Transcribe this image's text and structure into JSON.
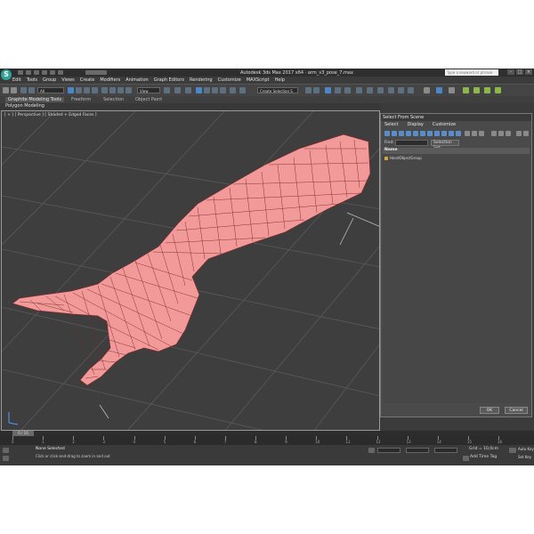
{
  "window": {
    "title": "Autodesk 3ds Max 2017 x64 · arm_v3_pose_7.max",
    "search_placeholder": "Type a keyword or phrase"
  },
  "menu": [
    "Edit",
    "Tools",
    "Group",
    "Views",
    "Create",
    "Modifiers",
    "Animation",
    "Graph Editors",
    "Rendering",
    "Customize",
    "MAXScript",
    "Help"
  ],
  "toolbar": {
    "filter_dropdown": "All",
    "reference_dropdown": "View",
    "selection_set_dropdown": "Create Selection S"
  },
  "ribbon": {
    "tabs": [
      "Graphite Modeling Tools",
      "Freeform",
      "Selection",
      "Object Paint"
    ],
    "active_tab": "Graphite Modeling Tools",
    "sub_label": "Polygon Modeling"
  },
  "viewport": {
    "label": "[ + ] [ Perspective ] [ Shaded + Edged Faces ]",
    "mesh_color": "#f29a9a",
    "wire_color": "#7a2a2a",
    "background": "#3e3e3e"
  },
  "dialog": {
    "title": "Select From Scene",
    "menu": [
      "Select",
      "Display",
      "Customize"
    ],
    "find_label": "Find:",
    "selection_set_label": "Selection Set:",
    "column_name": "Name",
    "rows": [
      "HandObjectGroup"
    ],
    "ok_label": "OK",
    "cancel_label": "Cancel"
  },
  "timeline": {
    "frame_display": "0 / 16",
    "ticks": [
      "0",
      "1",
      "2",
      "3",
      "4",
      "5",
      "6",
      "7",
      "8",
      "9",
      "10",
      "11",
      "12",
      "13",
      "14",
      "15",
      "16"
    ]
  },
  "status": {
    "selection": "None Selected",
    "hint": "Click or click-and-drag to zoom in and out",
    "grid": "Grid = 10,0cm",
    "add_time_tag": "Add Time Tag",
    "auto_key": "Auto Key",
    "set_key": "Set Key"
  }
}
